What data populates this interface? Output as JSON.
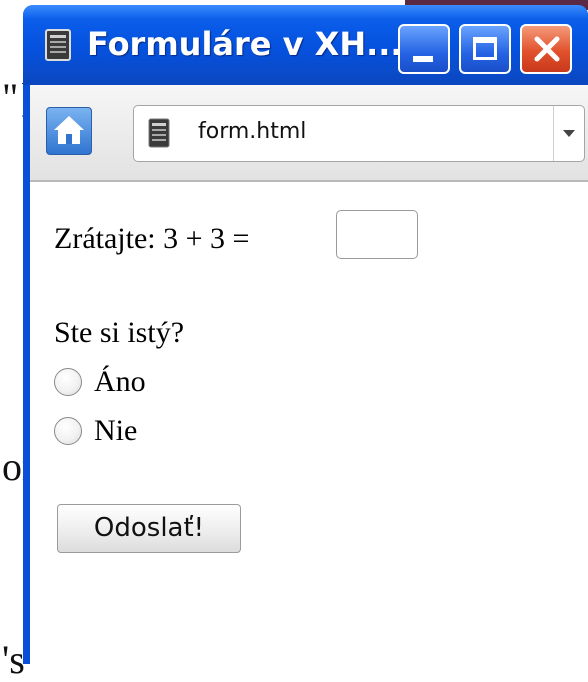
{
  "background": {
    "fragment_top": "\"}",
    "fragment_middle": "or",
    "fragment_bottom": "'s'"
  },
  "window": {
    "title": "Formuláre v XH...",
    "title_icon": "page-icon",
    "controls": {
      "minimize_icon": "minimize-icon",
      "maximize_icon": "maximize-icon",
      "close_icon": "close-icon"
    },
    "colors": {
      "titlebar": "#0551de",
      "close": "#e2522d"
    }
  },
  "toolbar": {
    "home_icon": "home-icon",
    "address": "form.html",
    "dropdown_icon": "chevron-down-icon"
  },
  "form": {
    "sum_label": "Zrátajte: 3 + 3 =",
    "sum_value": "",
    "question": "Ste si istý?",
    "options": [
      {
        "label": "Áno",
        "selected": false
      },
      {
        "label": "Nie",
        "selected": false
      }
    ],
    "submit_label": "Odoslať!"
  }
}
